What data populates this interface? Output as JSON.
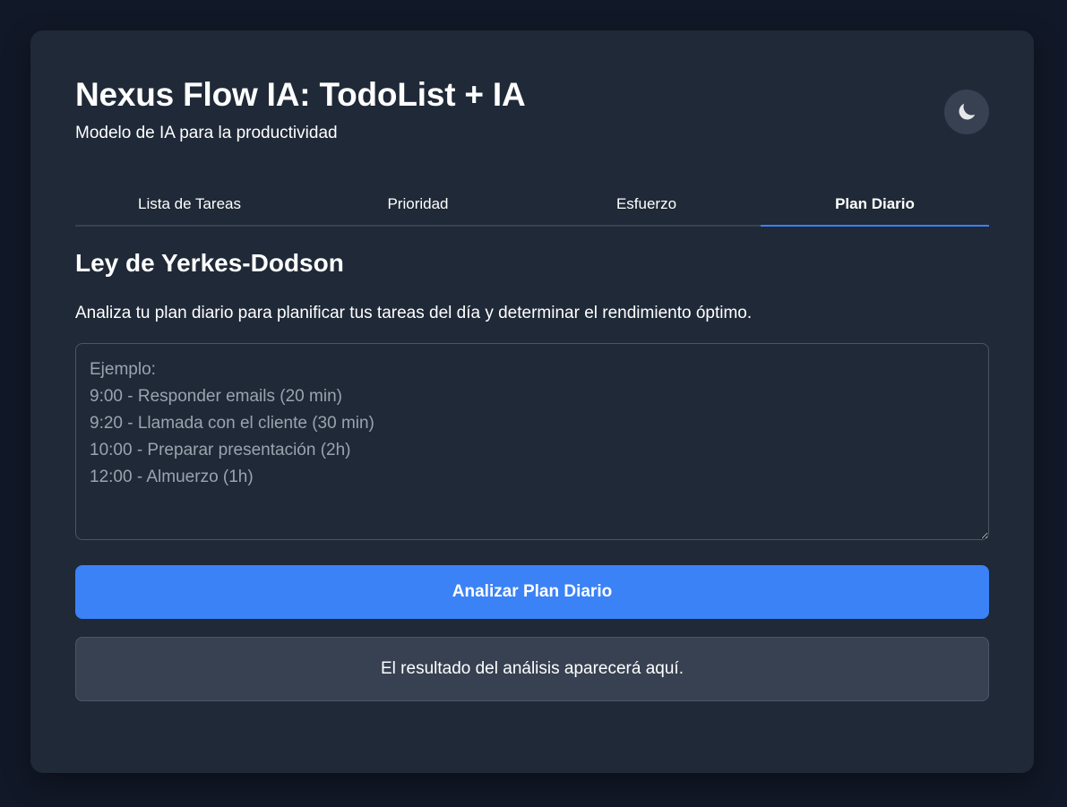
{
  "app": {
    "title": "Nexus Flow IA: TodoList + IA",
    "subtitle": "Modelo de IA para la productividad",
    "theme_toggle_icon": "moon-icon"
  },
  "tabs": [
    {
      "label": "Lista de Tareas",
      "active": false
    },
    {
      "label": "Prioridad",
      "active": false
    },
    {
      "label": "Esfuerzo",
      "active": false
    },
    {
      "label": "Plan Diario",
      "active": true
    }
  ],
  "section": {
    "title": "Ley de Yerkes-Dodson",
    "description": "Analiza tu plan diario para planificar tus tareas del día y determinar el rendimiento óptimo."
  },
  "plan_input": {
    "value": "",
    "placeholder": "Ejemplo:\n9:00 - Responder emails (20 min)\n9:20 - Llamada con el cliente (30 min)\n10:00 - Preparar presentación (2h)\n12:00 - Almuerzo (1h)"
  },
  "analyze_button": {
    "label": "Analizar Plan Diario"
  },
  "result": {
    "text": "El resultado del análisis aparecerá aquí."
  },
  "colors": {
    "background": "#111827",
    "card": "#1f2937",
    "accent": "#3b82f6",
    "result_bg": "#374151"
  }
}
